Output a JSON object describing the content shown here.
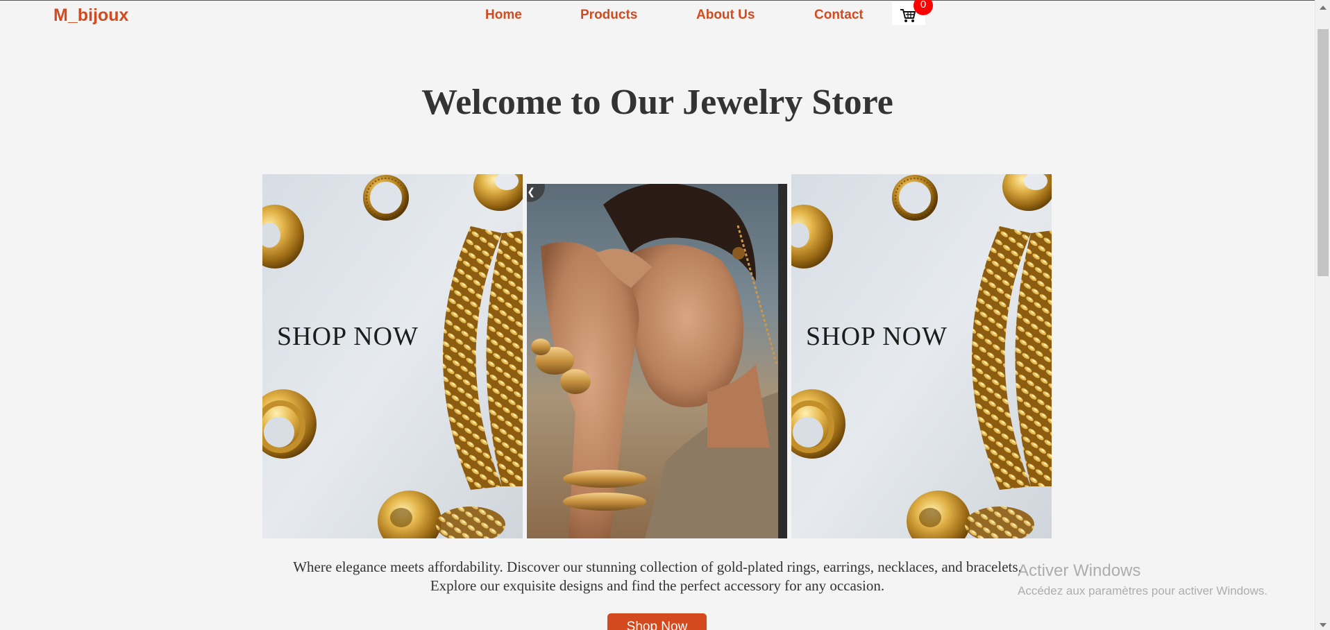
{
  "header": {
    "logo": "M_bijoux",
    "nav": [
      {
        "label": "Home"
      },
      {
        "label": "Products"
      },
      {
        "label": "About Us"
      },
      {
        "label": "Contact"
      }
    ],
    "cart": {
      "icon": "cart-icon",
      "count": "0"
    }
  },
  "hero": {
    "title": "Welcome to Our Jewelry Store"
  },
  "carousel": {
    "slides": [
      {
        "overlay_text": "SHOP NOW",
        "image": "gold-rings-and-chains"
      },
      {
        "image": "woman-wearing-gold-jewelry"
      },
      {
        "overlay_text": "SHOP NOW",
        "image": "gold-rings-and-chains"
      }
    ],
    "prev_icon": "chevron-left-icon"
  },
  "tagline": {
    "line1": "Where elegance meets affordability. Discover our stunning collection of gold-plated rings, earrings, necklaces, and bracelets.",
    "line2": "Explore our exquisite designs and find the perfect accessory for any occasion."
  },
  "cta": {
    "label": "Shop Now"
  },
  "watermark": {
    "title": "Activer Windows",
    "subtitle": "Accédez aux paramètres pour activer Windows."
  },
  "colors": {
    "brand": "#d24a1e",
    "background": "#f4f4f4",
    "text": "#333333",
    "badge": "#ff0000"
  }
}
